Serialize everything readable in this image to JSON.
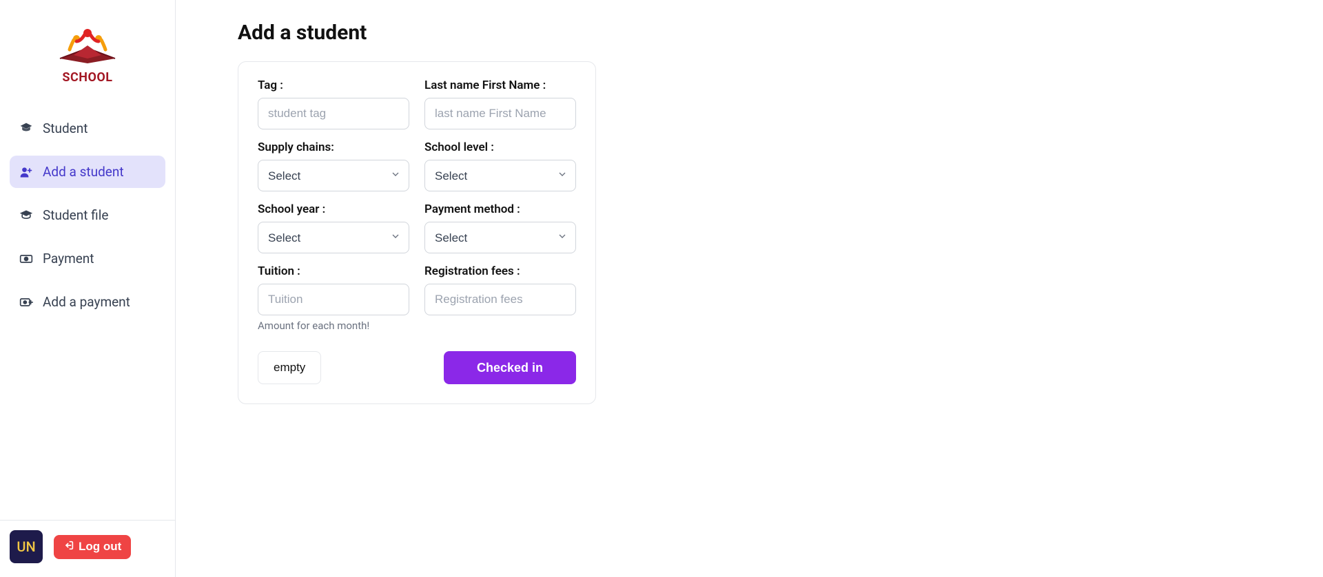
{
  "logo": {
    "text": "SCHOOL"
  },
  "sidebar": {
    "items": [
      {
        "id": "student",
        "label": "Student"
      },
      {
        "id": "add-student",
        "label": "Add a student"
      },
      {
        "id": "student-file",
        "label": "Student file"
      },
      {
        "id": "payment",
        "label": "Payment"
      },
      {
        "id": "add-payment",
        "label": "Add a payment"
      }
    ]
  },
  "user": {
    "initials": "UN"
  },
  "buttons": {
    "logout": "Log out",
    "empty": "empty",
    "submit": "Checked in"
  },
  "page": {
    "title": "Add a student"
  },
  "form": {
    "tag": {
      "label": "Tag :",
      "placeholder": "student tag",
      "value": ""
    },
    "name": {
      "label": "Last name First Name :",
      "placeholder": "last name First Name",
      "value": ""
    },
    "supply": {
      "label": "Supply chains:",
      "selected": "Select"
    },
    "level": {
      "label": "School level :",
      "selected": "Select"
    },
    "year": {
      "label": "School year :",
      "selected": "Select"
    },
    "paymethod": {
      "label": "Payment method :",
      "selected": "Select"
    },
    "tuition": {
      "label": "Tuition :",
      "placeholder": "Tuition",
      "value": "",
      "help": "Amount for each month!"
    },
    "regfees": {
      "label": "Registration fees :",
      "placeholder": "Registration fees",
      "value": ""
    }
  }
}
